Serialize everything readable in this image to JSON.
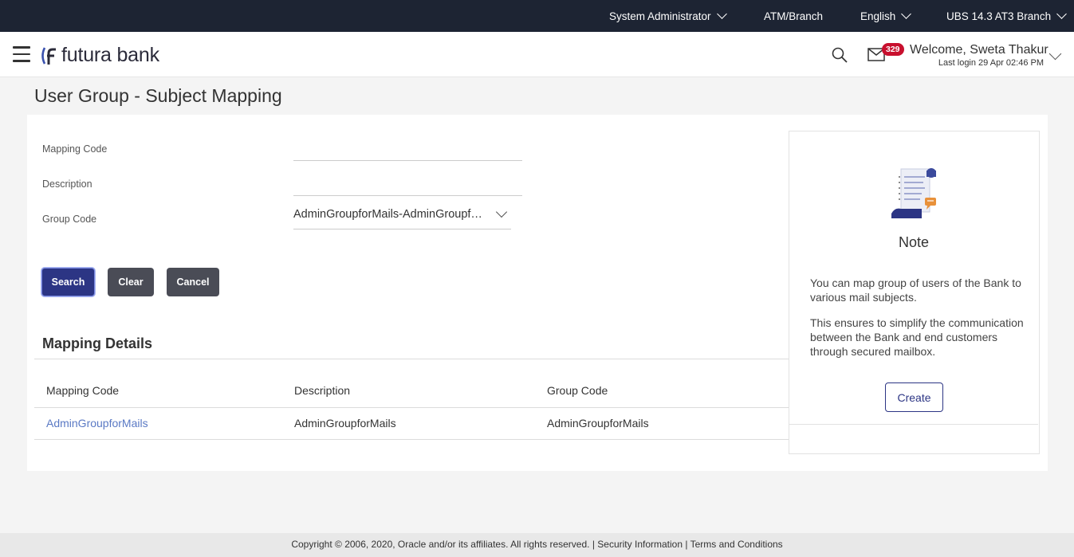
{
  "topbar": {
    "role": "System Administrator",
    "atm_branch": "ATM/Branch",
    "language": "English",
    "branch": "UBS 14.3 AT3 Branch"
  },
  "header": {
    "brand": "futura bank",
    "mail_count": "329",
    "welcome": "Welcome, Sweta Thakur",
    "last_login": "Last login 29 Apr 02:46 PM"
  },
  "page": {
    "title": "User Group - Subject Mapping"
  },
  "form": {
    "mapping_code_label": "Mapping Code",
    "mapping_code_value": "",
    "description_label": "Description",
    "description_value": "",
    "group_code_label": "Group Code",
    "group_code_value": "AdminGroupforMails-AdminGroupforMails"
  },
  "buttons": {
    "search": "Search",
    "clear": "Clear",
    "cancel": "Cancel"
  },
  "details": {
    "title": "Mapping Details",
    "columns": [
      "Mapping Code",
      "Description",
      "Group Code"
    ],
    "rows": [
      {
        "mapping_code": "AdminGroupforMails",
        "description": "AdminGroupforMails",
        "group_code": "AdminGroupforMails"
      }
    ]
  },
  "note": {
    "title": "Note",
    "text1": "You can map group of users of the Bank to various mail subjects.",
    "text2": "This ensures to simplify the communication between the Bank and end customers through secured mailbox.",
    "create": "Create"
  },
  "footer": {
    "copyright": "Copyright © 2006, 2020, Oracle and/or its affiliates. All rights reserved.",
    "separator": "|",
    "security": "Security Information",
    "terms": "Terms and Conditions"
  },
  "colors": {
    "primary": "#2c3584",
    "secondary_btn": "#4a4c56",
    "topbar": "#1d2433",
    "badge": "#c8102e",
    "link": "#5a79c4"
  },
  "icons": [
    "hamburger-icon",
    "bank-logo",
    "search-icon",
    "mail-icon",
    "chevron-down-icon",
    "note-illustration"
  ]
}
